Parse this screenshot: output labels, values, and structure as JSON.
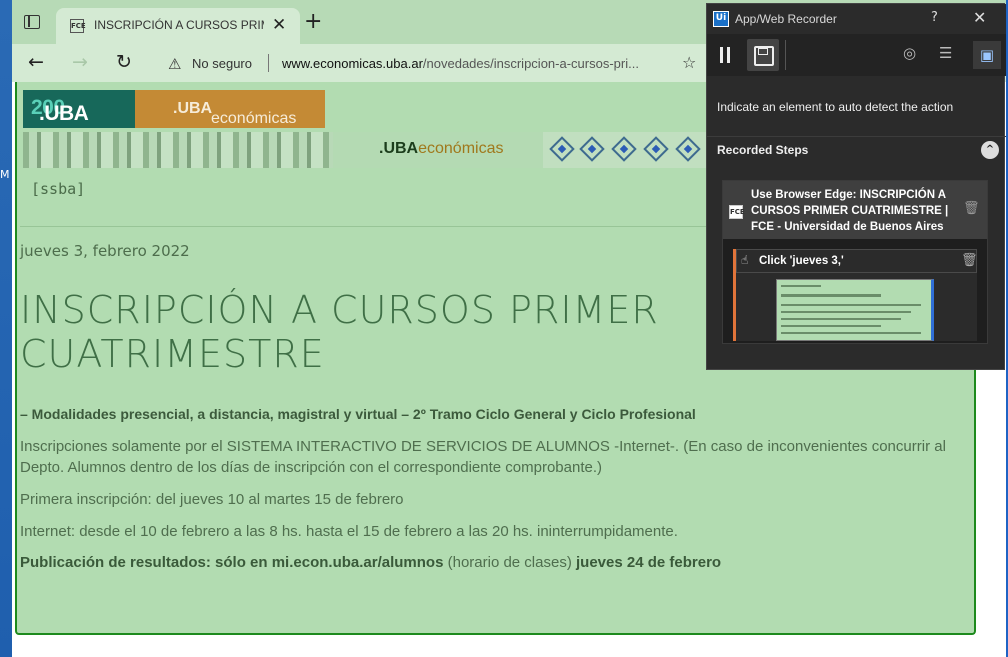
{
  "desktop": {
    "edge_letter": "M"
  },
  "browser": {
    "tab_title": "INSCRIPCIÓN A CURSOS PRIMER CUATRIMESTRE | FCE",
    "tab_favicon": "FCE",
    "close_glyph": "✕",
    "new_tab_glyph": "+",
    "back_glyph": "←",
    "forward_glyph": "→",
    "reload_glyph": "↻",
    "warning_glyph": "⚠",
    "security_label": "No seguro",
    "url_host": "www.economicas.uba.ar",
    "url_path": "/novedades/inscripcion-a-cursos-pri...",
    "favorite_glyph": "☆"
  },
  "page": {
    "logo_uba_a": ".UBA",
    "logo_uba_b": "200",
    "logo_eco_a": ".UBA",
    "logo_eco_b": "económicas",
    "banner_a": ".UBA",
    "banner_b": "económicas",
    "ssba": "[ssba]",
    "date": "jueves 3, febrero 2022",
    "title_line1": "INSCRIPCIÓN A CURSOS PRIMER",
    "title_line2": "CUATRIMESTRE",
    "subtitle": "– Modalidades presencial, a distancia, magistral y virtual – 2º Tramo Ciclo General y Ciclo Profesional",
    "p1": "Inscripciones solamente por el SISTEMA INTERACTIVO DE SERVICIOS DE ALUMNOS -Internet-. (En caso de inconvenientes concurrir al Depto. Alumnos dentro de los días de inscripción con el correspondiente comprobante.)",
    "p2": "Primera inscripción: del jueves 10 al martes 15 de febrero",
    "p3": "Internet: desde el 10 de febrero a las 8 hs. hasta el 15 de febrero a las 20 hs. ininterrumpidamente.",
    "p4_a": "Publicación de resultados: sólo en mi.econ.uba.ar/alumnos",
    "p4_b": " (horario de clases) ",
    "p4_c": "jueves 24 de febrero"
  },
  "recorder": {
    "logo": "Ui",
    "title": "App/Web Recorder",
    "help_glyph": "?",
    "close_glyph": "✕",
    "hint": "Indicate an element to auto detect the action",
    "steps_header": "Recorded Steps",
    "collapse_glyph": "^",
    "tool_target_glyph": "◎",
    "tool_list_glyph": "☰",
    "tool_screen_glyph": "▣",
    "step_favicon": "FCE",
    "step_title": "Use Browser Edge: INSCRIPCIÓN A CURSOS PRIMER CUATRIMESTRE | FCE - Universidad de Buenos Aires",
    "delete_glyph": "🗑",
    "click_icon": "☝",
    "click_step": "Click 'jueves 3,'"
  }
}
